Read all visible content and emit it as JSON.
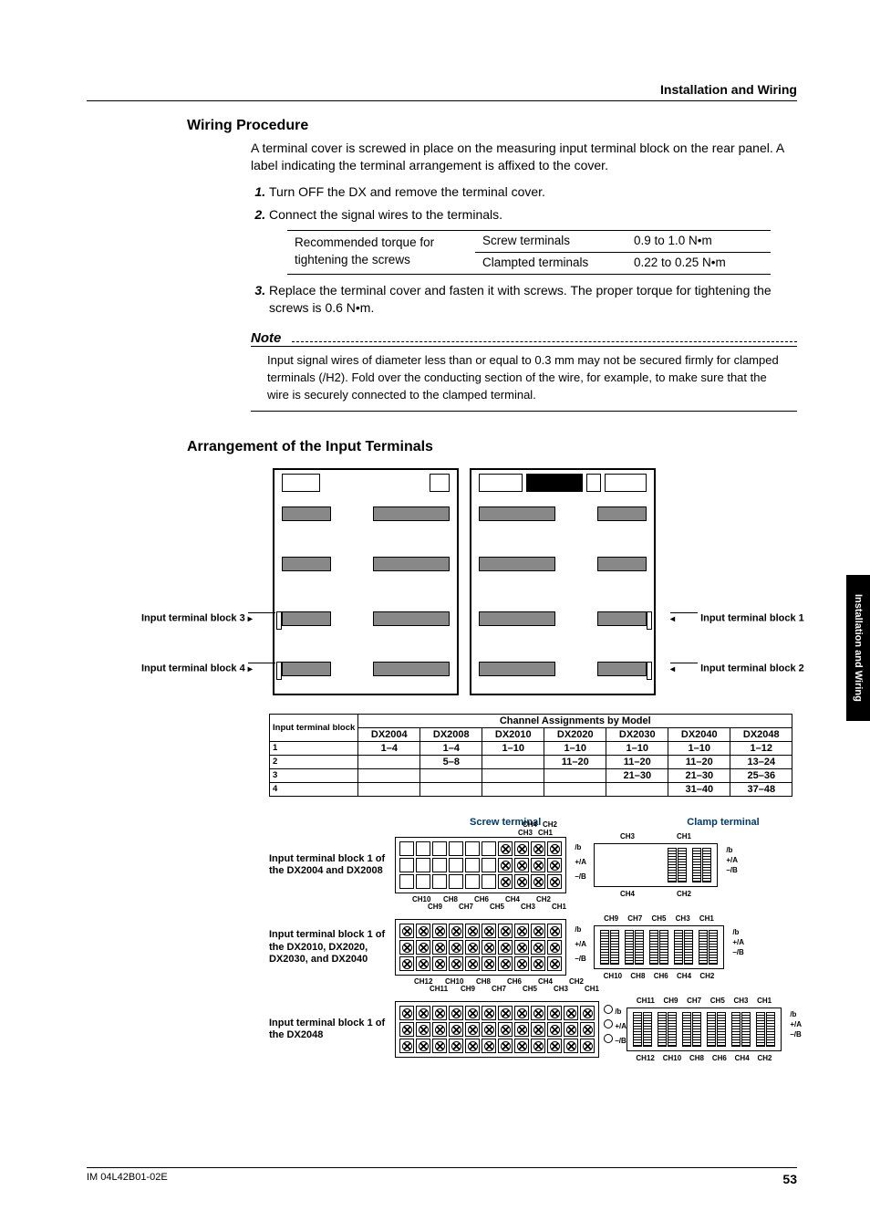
{
  "header": {
    "section_title": "Installation and Wiring"
  },
  "wiring": {
    "heading": "Wiring Procedure",
    "intro": "A terminal cover is screwed in place on the measuring input terminal block on the rear panel. A label indicating the terminal arrangement is affixed to the cover.",
    "steps": {
      "s1": "Turn OFF the DX and remove the terminal cover.",
      "s2": "Connect the signal wires to the terminals.",
      "s3": "Replace the terminal cover and fasten it with screws. The proper torque for tightening the screws is 0.6 N•m."
    },
    "torque_table": {
      "label": "Recommended torque for tightening the screws",
      "rows": [
        {
          "type": "Screw terminals",
          "value": "0.9 to 1.0 N•m"
        },
        {
          "type": "Clampted terminals",
          "value": "0.22 to 0.25 N•m"
        }
      ]
    }
  },
  "note": {
    "title": "Note",
    "text": "Input signal wires of diameter less than or equal to 0.3 mm may not be secured firmly for clamped terminals (/H2). Fold over the conducting section of the wire, for example, to make sure that the wire is securely connected to the clamped terminal."
  },
  "arrangement": {
    "heading": "Arrangement of the Input Terminals",
    "callouts": {
      "b1": "Input terminal block 1",
      "b2": "Input terminal block 2",
      "b3": "Input terminal block 3",
      "b4": "Input terminal block 4"
    }
  },
  "chan_table": {
    "head_label": "Input terminal block",
    "span_title": "Channel Assignments by Model",
    "models": [
      "DX2004",
      "DX2008",
      "DX2010",
      "DX2020",
      "DX2030",
      "DX2040",
      "DX2048"
    ],
    "rows": [
      {
        "blk": "1",
        "cells": [
          "1–4",
          "1–4",
          "1–10",
          "1–10",
          "1–10",
          "1–10",
          "1–12"
        ]
      },
      {
        "blk": "2",
        "cells": [
          "",
          "5–8",
          "",
          "11–20",
          "11–20",
          "11–20",
          "13–24"
        ]
      },
      {
        "blk": "3",
        "cells": [
          "",
          "",
          "",
          "",
          "21–30",
          "21–30",
          "25–36"
        ]
      },
      {
        "blk": "4",
        "cells": [
          "",
          "",
          "",
          "",
          "",
          "31–40",
          "37–48"
        ]
      }
    ]
  },
  "terminals": {
    "screw_header": "Screw terminal",
    "clamp_header": "Clamp terminal",
    "signals": {
      "b": "/b",
      "pa": "+/A",
      "nb": "–/B"
    },
    "group1": {
      "label": "Input terminal block 1 of the DX2004 and DX2008",
      "ch_top": [
        "CH4",
        "CH2"
      ],
      "ch_mid": [
        "CH3",
        "CH1"
      ],
      "clamp_top": [
        "CH3",
        "CH1"
      ],
      "clamp_bot": [
        "CH4",
        "CH2"
      ]
    },
    "group2": {
      "label": "Input terminal block 1 of the DX2010, DX2020, DX2030, and DX2040",
      "ch_top": [
        "CH10",
        "CH8",
        "CH6",
        "CH4",
        "CH2"
      ],
      "ch_mid": [
        "CH9",
        "CH7",
        "CH5",
        "CH3",
        "CH1"
      ],
      "clamp_top": [
        "CH9",
        "CH7",
        "CH5",
        "CH3",
        "CH1"
      ],
      "clamp_bot": [
        "CH10",
        "CH8",
        "CH6",
        "CH4",
        "CH2"
      ]
    },
    "group3": {
      "label": "Input terminal block 1 of the DX2048",
      "ch_top": [
        "CH12",
        "CH10",
        "CH8",
        "CH6",
        "CH4",
        "CH2"
      ],
      "ch_mid": [
        "CH11",
        "CH9",
        "CH7",
        "CH5",
        "CH3",
        "CH1"
      ],
      "clamp_top": [
        "CH11",
        "CH9",
        "CH7",
        "CH5",
        "CH3",
        "CH1"
      ],
      "clamp_bot": [
        "CH12",
        "CH10",
        "CH8",
        "CH6",
        "CH4",
        "CH2"
      ]
    }
  },
  "sidetab": {
    "text": "Installation and Wiring"
  },
  "footer": {
    "code": "IM 04L42B01-02E",
    "page": "53"
  }
}
